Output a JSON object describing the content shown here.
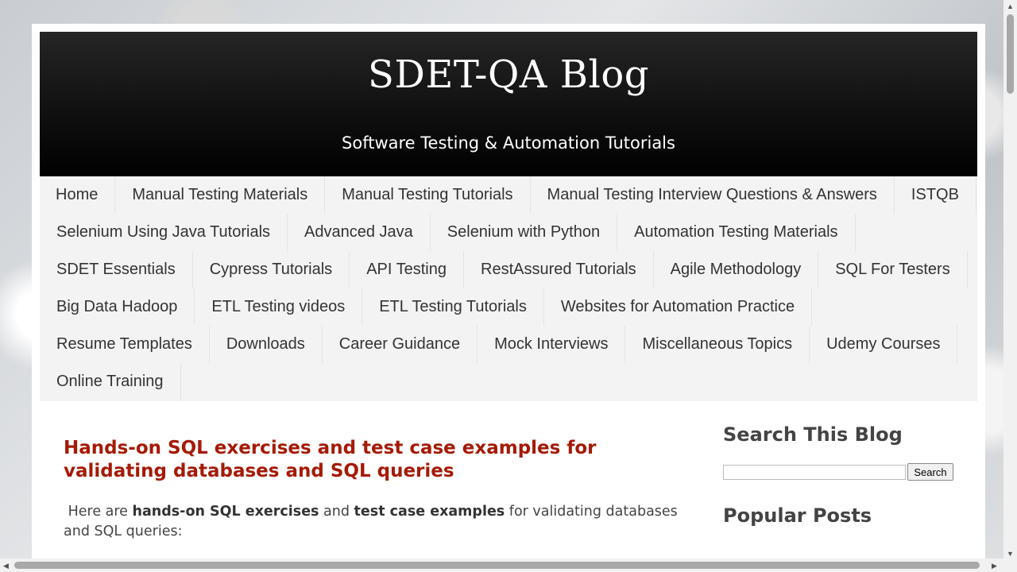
{
  "header": {
    "site_title": "SDET-QA Blog",
    "tagline": "Software Testing & Automation Tutorials"
  },
  "nav": {
    "items": [
      "Home",
      "Manual Testing Materials",
      "Manual Testing Tutorials",
      "Manual Testing Interview Questions & Answers",
      "ISTQB",
      "Selenium Using Java Tutorials",
      "Advanced Java",
      "Selenium with Python",
      "Automation Testing Materials",
      "SDET Essentials",
      "Cypress Tutorials",
      "API Testing",
      "RestAssured Tutorials",
      "Agile Methodology",
      "SQL For Testers",
      "Big Data Hadoop",
      "ETL Testing videos",
      "ETL Testing Tutorials",
      "Websites for Automation Practice",
      "Resume Templates",
      "Downloads",
      "Career Guidance",
      "Mock Interviews",
      "Miscellaneous Topics",
      "Udemy Courses",
      "Online Training"
    ]
  },
  "post": {
    "title": "Hands-on SQL exercises and test case examples for validating databases and SQL queries",
    "intro_prefix": "Here are ",
    "intro_bold_1": "hands-on SQL exercises",
    "intro_mid": " and ",
    "intro_bold_2": "test case examples",
    "intro_suffix": " for validating databases and SQL queries:"
  },
  "sidebar": {
    "search_title": "Search This Blog",
    "search_value": "",
    "search_button": "Search",
    "popular_title": "Popular Posts"
  },
  "colors": {
    "post_title": "#a51a06",
    "header_bg": "#000000",
    "nav_bg": "#f3f3f3"
  },
  "icons": {
    "scroll_up": "triangle-up",
    "scroll_down": "triangle-down",
    "scroll_left": "triangle-left",
    "scroll_right": "triangle-right"
  }
}
